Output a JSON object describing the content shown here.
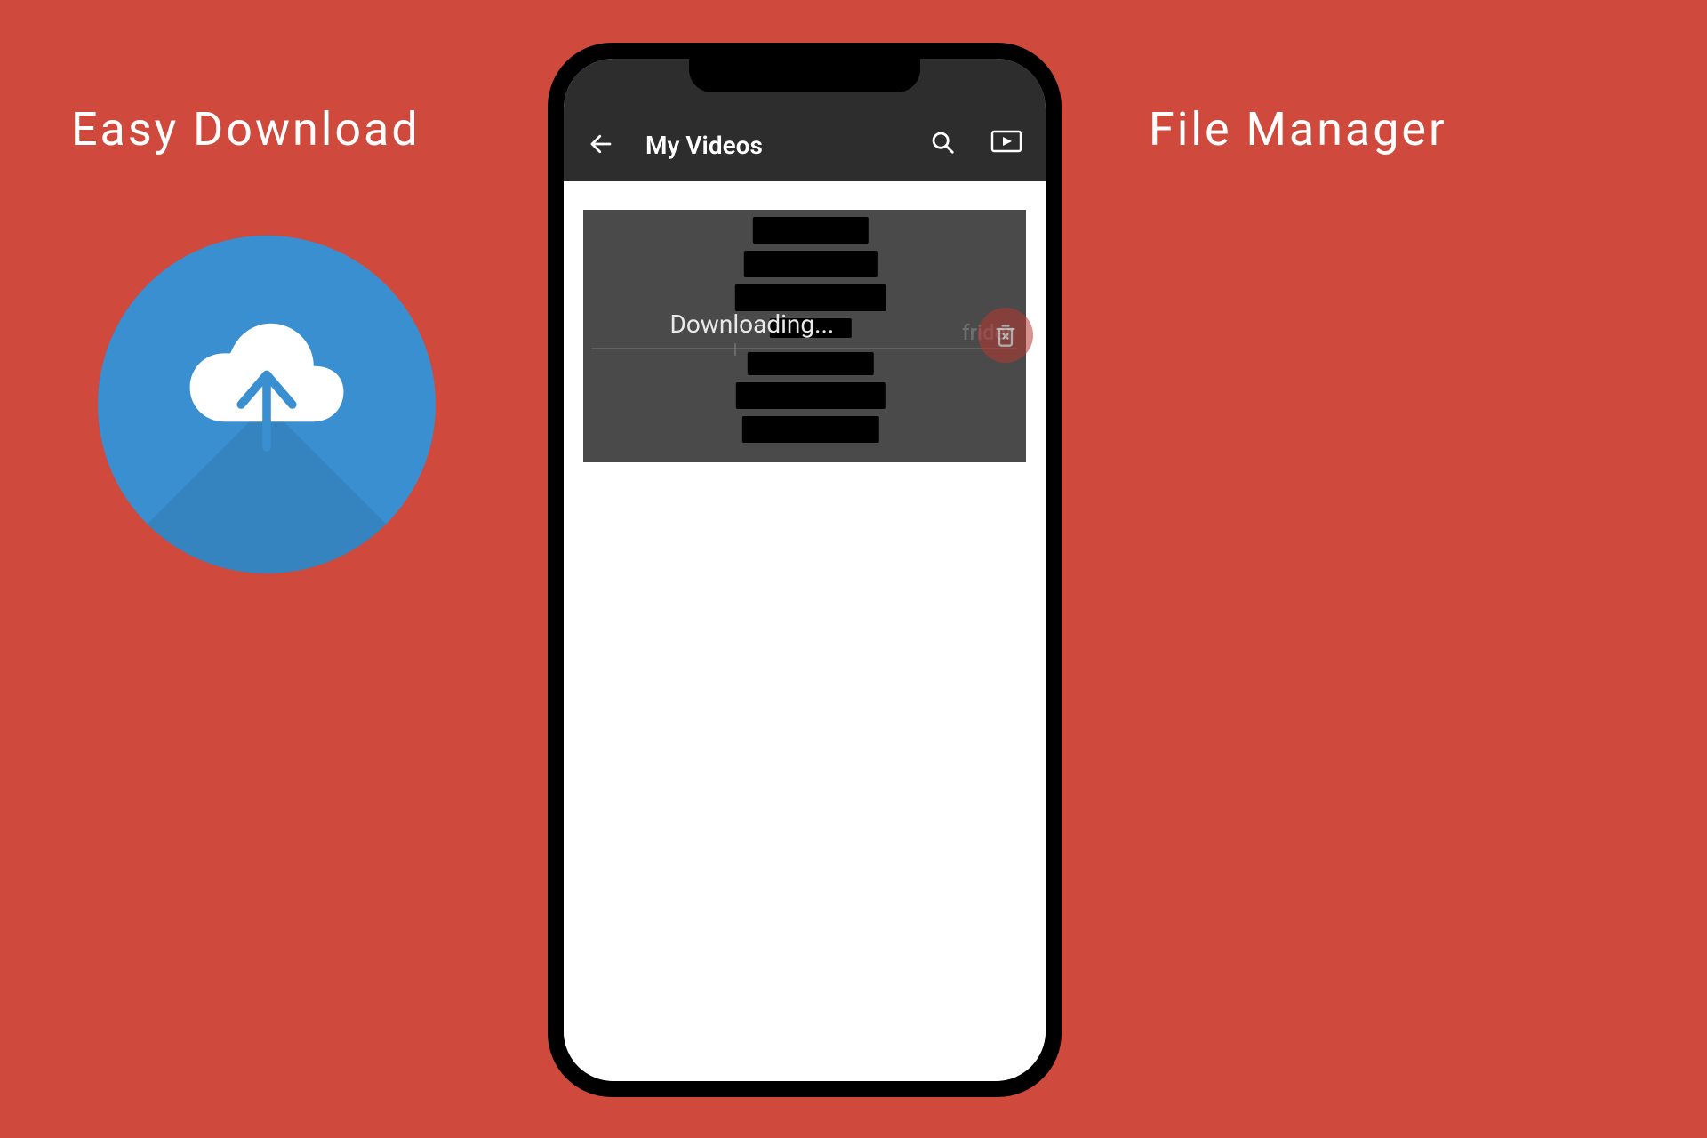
{
  "left_caption": "Easy Download",
  "right_caption": "File Manager",
  "phone": {
    "header": {
      "title": "My Videos"
    },
    "video_card": {
      "status_label": "Downloading...",
      "hint_text": "frider"
    }
  }
}
